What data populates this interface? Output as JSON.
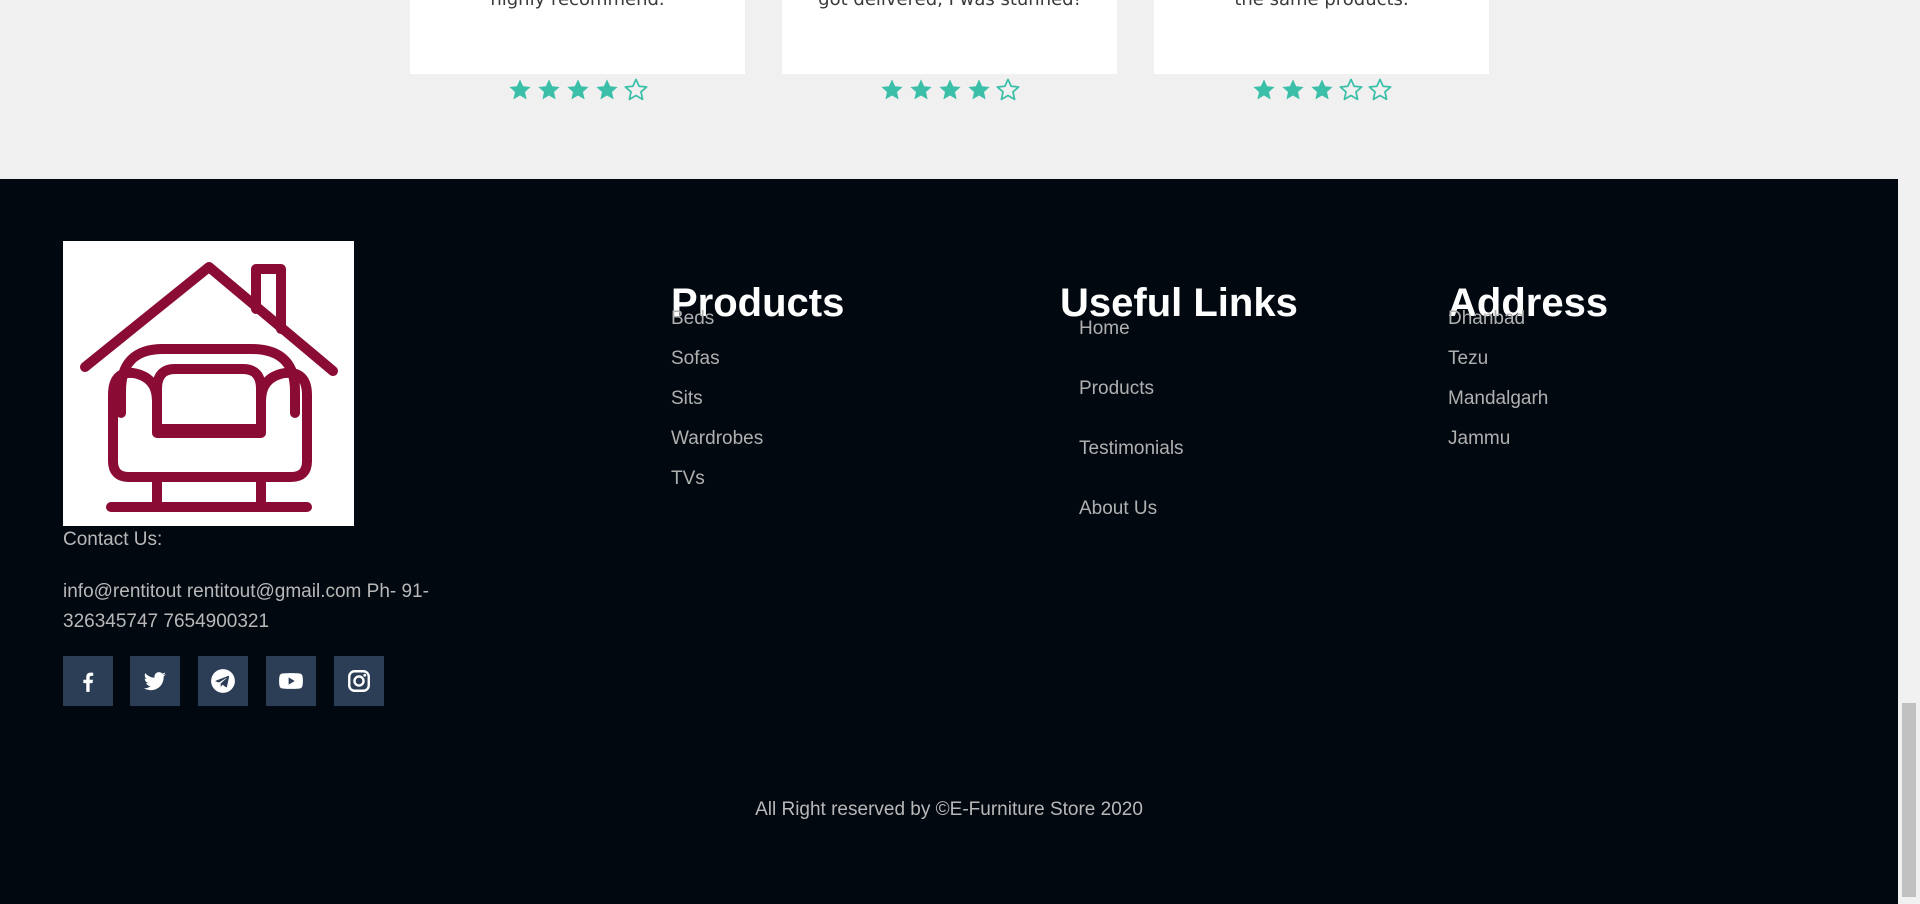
{
  "testimonials": {
    "cards": [
      {
        "text": "highly recommend.",
        "rating": 4
      },
      {
        "text": "got delivered, I was stunned!",
        "rating": 4
      },
      {
        "text": "the same products.",
        "rating": 3
      }
    ],
    "max_rating": 5,
    "star_color": "#3bbfa8"
  },
  "footer": {
    "logo_alt": "house-armchair-logo",
    "logo_color": "#8a0b34",
    "contact_title": "Contact Us:",
    "contact_info": "info@rentitout rentitout@gmail.com Ph- 91-326345747 7654900321",
    "socials": [
      {
        "icon": "facebook-icon"
      },
      {
        "icon": "twitter-icon"
      },
      {
        "icon": "telegram-icon"
      },
      {
        "icon": "youtube-icon"
      },
      {
        "icon": "instagram-icon"
      }
    ],
    "products": {
      "title": "Products",
      "items": [
        "Beds",
        "Sofas",
        "Sits",
        "Wardrobes",
        "TVs"
      ]
    },
    "useful_links": {
      "title": "Useful Links",
      "items": [
        "Home",
        "Products",
        "Testimonials",
        "About Us"
      ]
    },
    "address": {
      "title": "Address",
      "items": [
        "Dhanbad",
        "Tezu",
        "Mandalgarh",
        "Jammu"
      ]
    },
    "copyright": "All Right reserved by ©E-Furniture Store 2020"
  },
  "colors": {
    "footer_bg": "#020810",
    "social_bg": "#2b3e55",
    "page_bg": "#f0f0f0"
  }
}
